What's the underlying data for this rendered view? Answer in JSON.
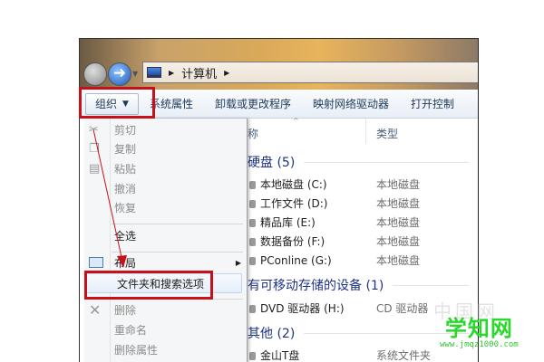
{
  "address": {
    "crumb": "计算机"
  },
  "toolbar": {
    "organize": "组织",
    "items": [
      "系统属性",
      "卸载或更改程序",
      "映射网络驱动器",
      "打开控制"
    ]
  },
  "menu": {
    "items": [
      "剪切",
      "复制",
      "粘贴",
      "撤消",
      "恢复",
      "全选",
      "布局",
      "文件夹和搜索选项",
      "删除",
      "重命名",
      "删除属性"
    ]
  },
  "columns": {
    "name": "称",
    "type": "类型"
  },
  "groups": [
    {
      "title": "硬盘 (5)",
      "items": [
        {
          "name": "本地磁盘 (C:)",
          "type": "本地磁盘"
        },
        {
          "name": "工作文件 (D:)",
          "type": "本地磁盘"
        },
        {
          "name": "精品库 (E:)",
          "type": "本地磁盘"
        },
        {
          "name": "数据备份 (F:)",
          "type": "本地磁盘"
        },
        {
          "name": "PConline (G:)",
          "type": "本地磁盘"
        }
      ]
    },
    {
      "title": "有可移动存储的设备 (1)",
      "items": [
        {
          "name": "DVD 驱动器 (H:)",
          "type": "CD 驱动器"
        }
      ]
    },
    {
      "title": "其他 (2)",
      "items": [
        {
          "name": "金山T盘",
          "type": "系统文件夹"
        }
      ]
    }
  ],
  "watermark": {
    "name": "学知网",
    "url": "www.jmqz1000.com",
    "faint": "中国网"
  },
  "colors": {
    "highlight": "#c8101a",
    "watermark": "#29d82a"
  }
}
